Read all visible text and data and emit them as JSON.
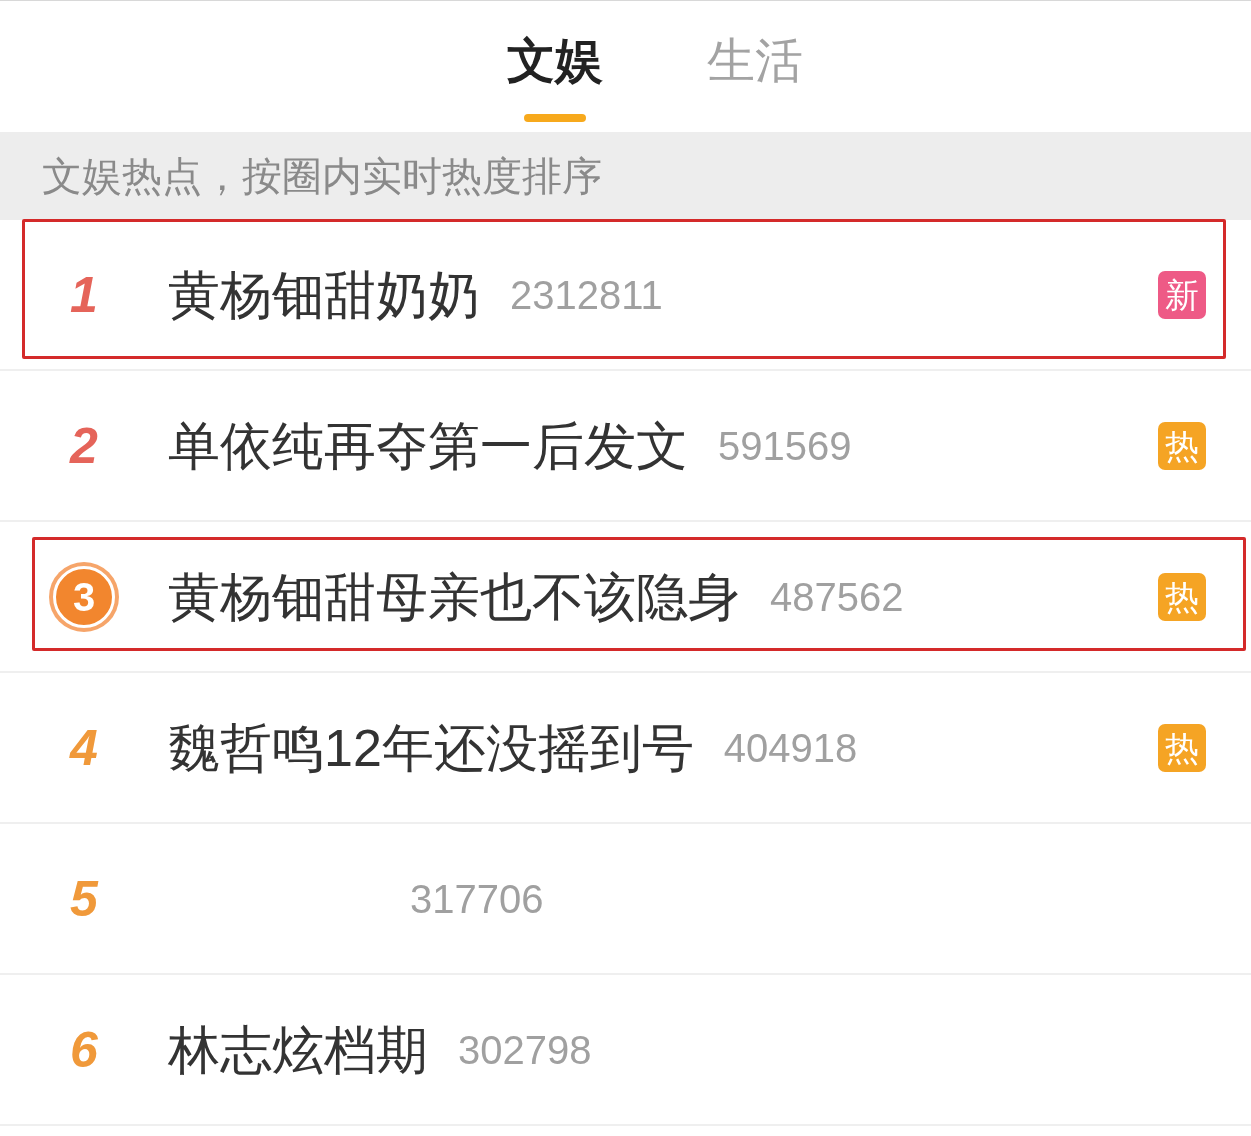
{
  "tabs": [
    {
      "label": "文娱",
      "selected": true
    },
    {
      "label": "生活",
      "selected": false
    }
  ],
  "banner": "文娱热点，按圈内实时热度排序",
  "rows": [
    {
      "rank": "1",
      "kind": "number",
      "color": "#e5645a",
      "title": "黄杨钿甜奶奶",
      "count": "2312811",
      "badge": {
        "label": "新",
        "color": "#ee5a86"
      },
      "highlighted": true
    },
    {
      "rank": "2",
      "kind": "number",
      "color": "#e5645a",
      "title": "单依纯再夺第一后发文",
      "count": "591569",
      "badge": {
        "label": "热",
        "color": "#f5a424"
      },
      "highlighted": false
    },
    {
      "rank": "3",
      "kind": "medal",
      "color": "#f2862e",
      "title": "黄杨钿甜母亲也不该隐身",
      "count": "487562",
      "badge": {
        "label": "热",
        "color": "#f5a424"
      },
      "highlighted": true
    },
    {
      "rank": "4",
      "kind": "number",
      "color": "#f0993a",
      "title": "魏哲鸣12年还没摇到号",
      "count": "404918",
      "badge": {
        "label": "热",
        "color": "#f5a424"
      },
      "highlighted": false
    },
    {
      "rank": "5",
      "kind": "number",
      "color": "#f0993a",
      "count": "317706",
      "highlighted": false
    },
    {
      "rank": "6",
      "kind": "number",
      "color": "#f0993a",
      "title": "林志炫档期",
      "count": "302798",
      "highlighted": false
    }
  ]
}
